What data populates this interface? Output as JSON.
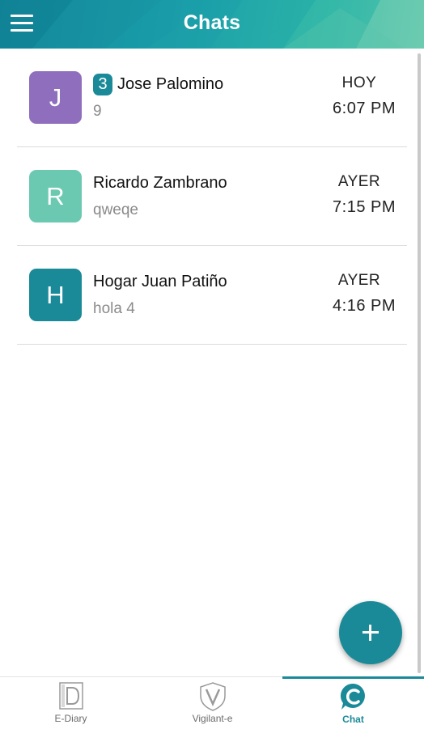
{
  "header": {
    "title": "Chats",
    "menu_icon": "hamburger-menu-icon"
  },
  "chats": [
    {
      "initial": "J",
      "avatar_color": "#8f6fbd",
      "unread": "3",
      "name": "Jose Palomino",
      "preview": "9",
      "day": "HOY",
      "time": "6:07 PM"
    },
    {
      "initial": "R",
      "avatar_color": "#6cc9b1",
      "name": "Ricardo Zambrano",
      "preview": "qweqe",
      "day": "AYER",
      "time": "7:15 PM"
    },
    {
      "initial": "H",
      "avatar_color": "#1a8a99",
      "name": "Hogar Juan Patiño",
      "preview": "hola 4",
      "day": "AYER",
      "time": "4:16 PM"
    }
  ],
  "fab": {
    "icon": "plus-icon"
  },
  "tabs": [
    {
      "label": "E-Diary",
      "icon": "ediary-d-icon"
    },
    {
      "label": "Vigilant-e",
      "icon": "vigilant-shield-v-icon"
    },
    {
      "label": "Chat",
      "icon": "chat-c-icon",
      "active": true
    }
  ],
  "colors": {
    "accent": "#1a8a99",
    "header_gradient_start": "#13869a",
    "header_gradient_end": "#5ec7ad",
    "inactive_tab": "#6b6b6b"
  }
}
